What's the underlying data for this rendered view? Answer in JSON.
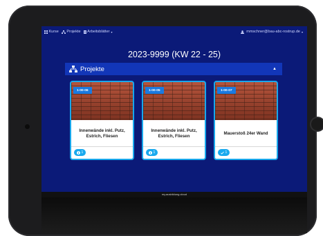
{
  "nav": {
    "kurse_label": "Kurse",
    "projekte_label": "Projekte",
    "arbeitsblaetter_label": "Arbeitsblätter",
    "user_email": "mmschner@bau-abc-rostrup.de"
  },
  "page": {
    "title": "2023-9999 (KW 22 - 25)"
  },
  "section": {
    "label": "Projekte"
  },
  "cards": [
    {
      "code": "1-00-06",
      "title": "Innenwände inkl. Putz, Estrich, Fliesen",
      "count": "1",
      "status_icon": "info-icon"
    },
    {
      "code": "1-00-05",
      "title": "Innenwände inkl. Putz, Estrich, Fliesen",
      "count": "1",
      "status_icon": "info-icon"
    },
    {
      "code": "1-00-07",
      "title": "Mauerstoß 24er Wand",
      "count": "1",
      "status_icon": "check-icon"
    }
  ],
  "footer": {
    "text": "my.ausbildung.cloud"
  },
  "colors": {
    "app_background": "#0b1a78",
    "section_bar": "#1236b8",
    "card_border": "#18a8ec",
    "badge": "#1a7ae0"
  }
}
